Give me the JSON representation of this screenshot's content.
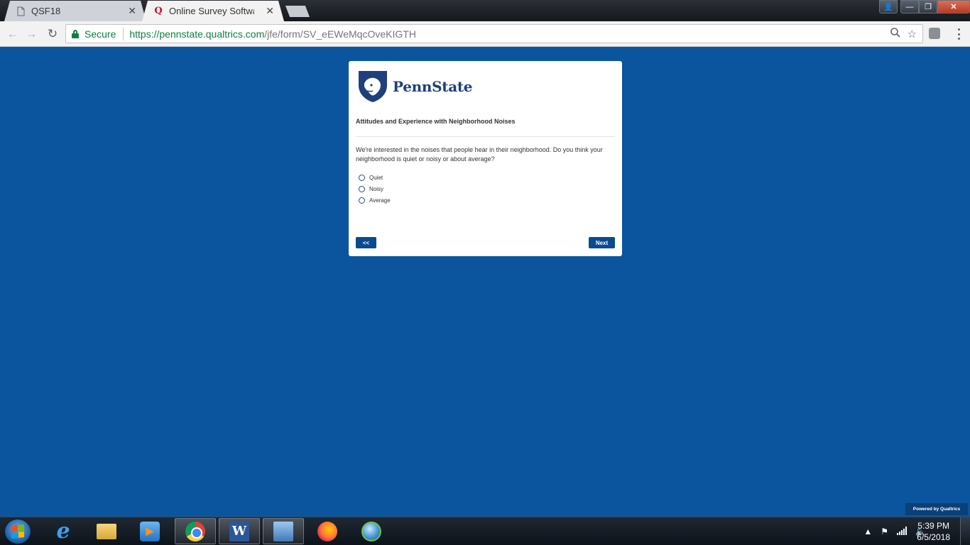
{
  "browser": {
    "tabs": [
      {
        "label": "QSF18",
        "icon": "document-icon",
        "active": false
      },
      {
        "label": "Online Survey Software |",
        "icon": "qualtrics-q-icon",
        "active": true
      }
    ],
    "address": {
      "secure_label": "Secure",
      "url_host": "https://pennstate.qualtrics.com",
      "url_path": "/jfe/form/SV_eEWeMqcOveKIGTH"
    },
    "accent": "#0b8043"
  },
  "survey": {
    "logo_text": "PennState",
    "title": "Attitudes and Experience with Neighborhood Noises",
    "question": "We're interested in the noises that people hear in their neighborhood. Do you think your neighborhood is quiet or noisy or about average?",
    "choices": [
      "Quiet",
      "Noisy",
      "Average"
    ],
    "back_label": "<<",
    "next_label": "Next",
    "powered_by": "Powered by Qualtrics",
    "colors": {
      "background": "#0b559e",
      "button": "#0b4a8d",
      "brand": "#1e407c"
    }
  },
  "taskbar": {
    "apps": [
      "internet-explorer",
      "file-explorer",
      "media-player",
      "chrome",
      "word",
      "remote-desktop",
      "firefox",
      "globe-app"
    ],
    "clock_time": "5:39 PM",
    "clock_date": "6/5/2018"
  }
}
